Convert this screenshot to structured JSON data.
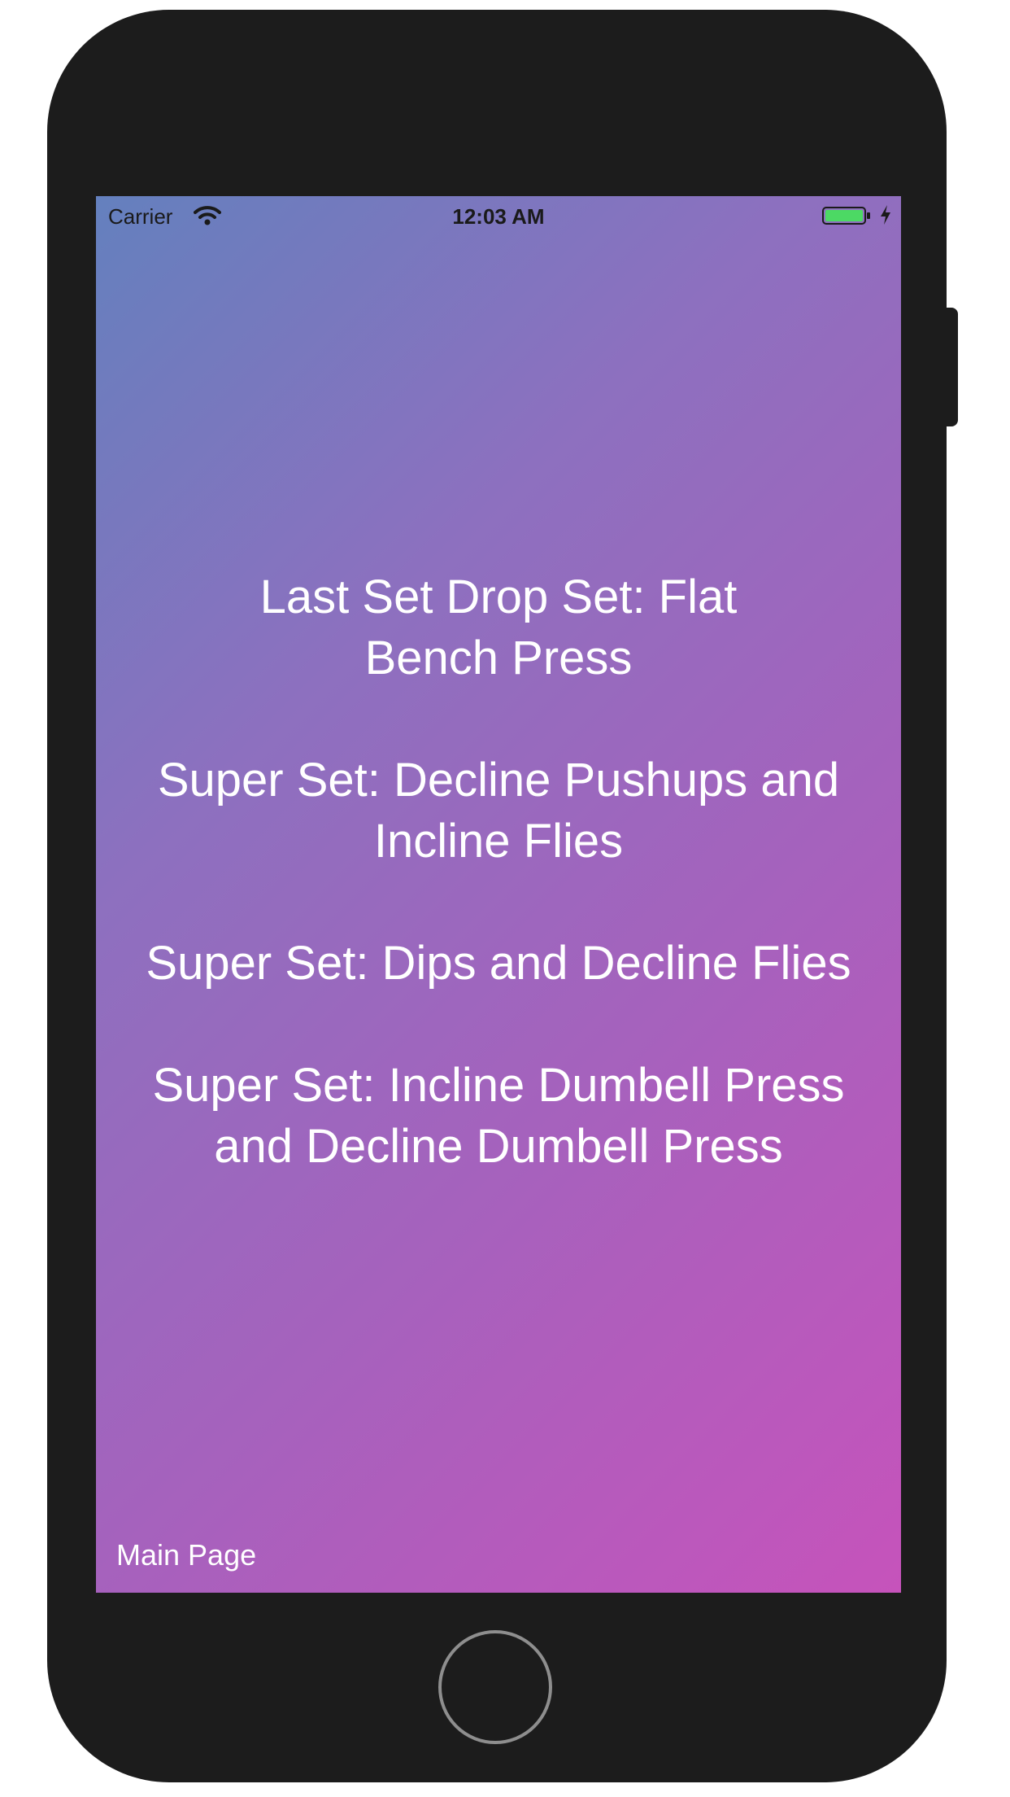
{
  "status_bar": {
    "carrier": "Carrier",
    "time": "12:03 AM",
    "battery_color": "#4cd964",
    "icons": [
      "wifi-icon",
      "battery-icon",
      "charging-bolt-icon"
    ]
  },
  "workouts": [
    {
      "label": "Last Set Drop Set: Flat Bench Press"
    },
    {
      "label": "Super Set: Decline Pushups and Incline Flies"
    },
    {
      "label": "Super Set: Dips and Decline Flies"
    },
    {
      "label": "Super Set: Incline Dumbell Press and Decline Dumbell Press"
    }
  ],
  "footer": {
    "main_page_label": "Main Page"
  },
  "colors": {
    "gradient_start": "#6480be",
    "gradient_end": "#c653bb",
    "device_body": "#1c1c1c"
  }
}
